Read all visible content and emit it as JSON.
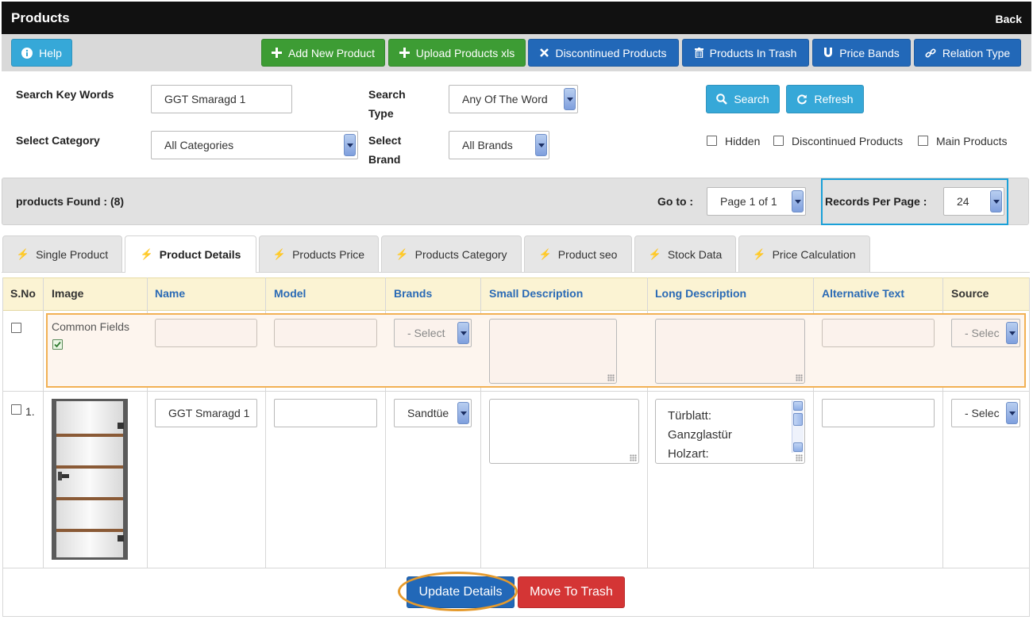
{
  "header": {
    "title": "Products",
    "back_label": "Back"
  },
  "toolbar": {
    "help": "Help",
    "add_new_product": "Add New Product",
    "upload_xls": "Upload Products xls",
    "discontinued": "Discontinued Products",
    "trash": "Products In Trash",
    "price_bands": "Price Bands",
    "relation_type": "Relation Type"
  },
  "search": {
    "keywords_label": "Search Key Words",
    "keywords_value": "GGT Smaragd 1",
    "type_label_1": "Search",
    "type_label_2": "Type",
    "type_value": "Any Of The Word",
    "category_label": "Select Category",
    "category_value": "All Categories",
    "brand_label_1": "Select",
    "brand_label_2": "Brand",
    "brand_value": "All Brands",
    "search_button": "Search",
    "refresh_button": "Refresh",
    "filters": [
      "Hidden",
      "Discontinued Products",
      "Main Products"
    ]
  },
  "results": {
    "found_text": "products Found : (8)",
    "goto_label": "Go to :",
    "page_value": "Page 1 of 1",
    "per_page_label": "Records Per Page :",
    "per_page_value": "24"
  },
  "tabs": [
    "Single Product",
    "Product Details",
    "Products Price",
    "Products Category",
    "Product seo",
    "Stock Data",
    "Price Calculation"
  ],
  "active_tab": "Product Details",
  "table": {
    "columns": [
      "S.No",
      "Image",
      "Name",
      "Model",
      "Brands",
      "Small Description",
      "Long Description",
      "Alternative Text",
      "Source"
    ],
    "common_fields_label": "Common Fields",
    "select_placeholder": "- Select",
    "select_short": "- Selec",
    "rows": [
      {
        "sno": "1.",
        "name": "GGT Smaragd 1",
        "model": "",
        "brand": "Sandtüe",
        "small_description": "",
        "long_description": [
          "Türblatt:",
          "Ganzglastür",
          "Holzart:"
        ],
        "alternative_text": "",
        "source": "- Selec"
      }
    ]
  },
  "actions": {
    "update": "Update Details",
    "trash": "Move To Trash"
  },
  "colors": {
    "titlebar": "#111111",
    "cyan_button": "#36a8d8",
    "green_button": "#3d9c34",
    "blue_button": "#2268b8",
    "red_button": "#d43535",
    "header_row": "#fbf3d3",
    "column_link": "#2a6ab5",
    "highlight_orange": "#f2b154",
    "highlight_cyan": "#1aa0d8"
  }
}
